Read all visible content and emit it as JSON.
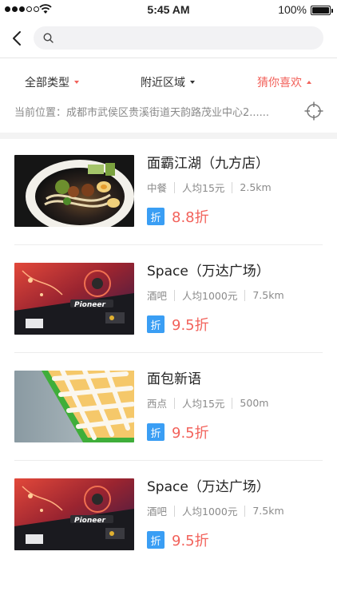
{
  "status_bar": {
    "time": "5:45 AM",
    "battery_label": "100%",
    "battery_level": 1.0,
    "signal_bars": 5,
    "signal_filled": 3
  },
  "search": {
    "value": "",
    "placeholder": ""
  },
  "filters": [
    {
      "label": "全部类型",
      "state": "collapsed"
    },
    {
      "label": "附近区域",
      "state": "collapsed"
    },
    {
      "label": "猜你喜欢",
      "state": "selected"
    }
  ],
  "location": {
    "text": "当前位置：成都市武侯区贵溪街道天韵路茂业中心2......"
  },
  "colors": {
    "accent": "#f2625b",
    "badge": "#3a9ef4",
    "muted": "#8a8a8a"
  },
  "items": [
    {
      "name": "面霸江湖（九方店）",
      "category": "中餐",
      "price": "人均15元",
      "distance": "2.5km",
      "badge": "折",
      "discount": "8.8折",
      "image": "noodle-bowl"
    },
    {
      "name": "Space（万达广场）",
      "category": "酒吧",
      "price": "人均1000元",
      "distance": "7.5km",
      "badge": "折",
      "discount": "9.5折",
      "image": "dj-turntable"
    },
    {
      "name": "面包新语",
      "category": "西点",
      "price": "人均15元",
      "distance": "500m",
      "badge": "折",
      "discount": "9.5折",
      "image": "lattice-pastry"
    },
    {
      "name": "Space（万达广场）",
      "category": "酒吧",
      "price": "人均1000元",
      "distance": "7.5km",
      "badge": "折",
      "discount": "9.5折",
      "image": "dj-turntable"
    }
  ]
}
